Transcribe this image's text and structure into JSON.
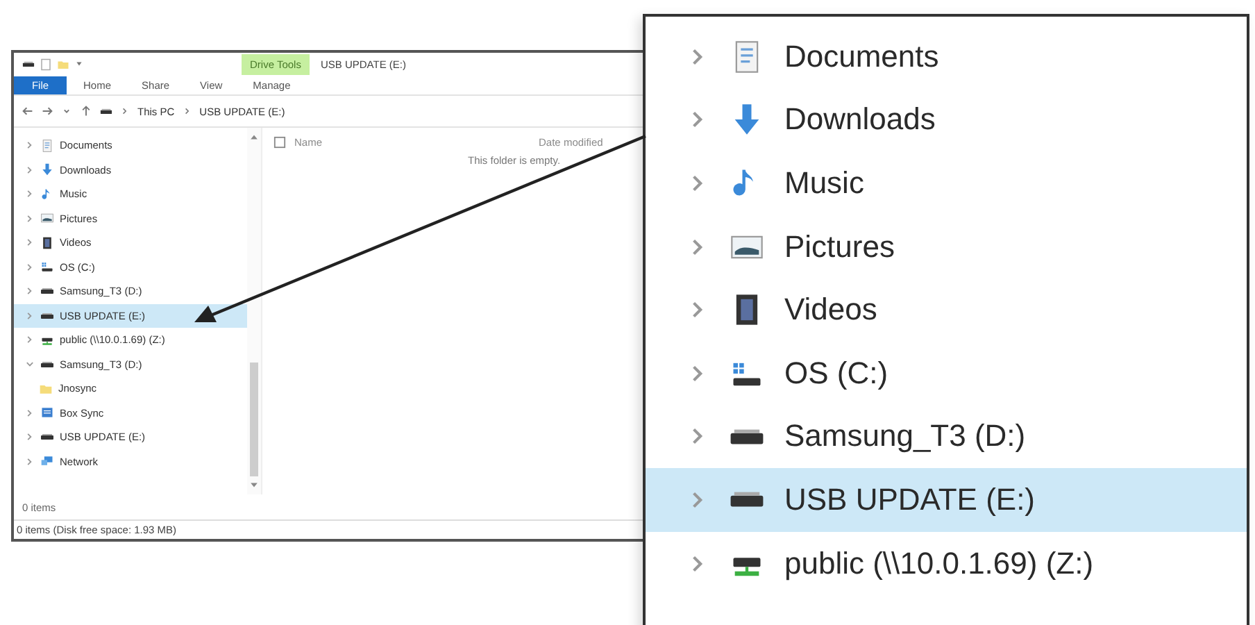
{
  "explorer": {
    "title_bar": {
      "context_tab": "Drive Tools",
      "title": "USB UPDATE (E:)"
    },
    "ribbon_tabs": [
      {
        "label": "File",
        "kind": "file"
      },
      {
        "label": "Home",
        "kind": "tab"
      },
      {
        "label": "Share",
        "kind": "tab"
      },
      {
        "label": "View",
        "kind": "tab"
      },
      {
        "label": "Manage",
        "kind": "tab"
      }
    ],
    "address": [
      "This PC",
      "USB UPDATE (E:)"
    ],
    "nav_tree": [
      {
        "label": "Documents",
        "kind": "documents",
        "expandable": true,
        "expanded": false,
        "selected": false
      },
      {
        "label": "Downloads",
        "kind": "downloads",
        "expandable": true,
        "expanded": false,
        "selected": false
      },
      {
        "label": "Music",
        "kind": "music",
        "expandable": true,
        "expanded": false,
        "selected": false
      },
      {
        "label": "Pictures",
        "kind": "pictures",
        "expandable": true,
        "expanded": false,
        "selected": false
      },
      {
        "label": "Videos",
        "kind": "videos",
        "expandable": true,
        "expanded": false,
        "selected": false
      },
      {
        "label": "OS (C:)",
        "kind": "system_drive",
        "expandable": true,
        "expanded": false,
        "selected": false
      },
      {
        "label": "Samsung_T3 (D:)",
        "kind": "drive",
        "expandable": true,
        "expanded": false,
        "selected": false
      },
      {
        "label": "USB UPDATE (E:)",
        "kind": "drive",
        "expandable": true,
        "expanded": false,
        "selected": true
      },
      {
        "label": "public (\\\\10.0.1.69) (Z:)",
        "kind": "network_drive",
        "expandable": true,
        "expanded": false,
        "selected": false
      },
      {
        "label": "Samsung_T3 (D:)",
        "kind": "drive",
        "expandable": true,
        "expanded": true,
        "selected": false,
        "children": [
          {
            "label": "Jnosync",
            "kind": "folder",
            "expandable": false,
            "expanded": false,
            "selected": false
          },
          {
            "label": "Box Sync",
            "kind": "box",
            "expandable": true,
            "expanded": false,
            "selected": false
          }
        ]
      },
      {
        "label": "USB UPDATE (E:)",
        "kind": "drive",
        "expandable": true,
        "expanded": false,
        "selected": false
      },
      {
        "label": "Network",
        "kind": "network",
        "expandable": true,
        "expanded": false,
        "selected": false
      }
    ],
    "columns": [
      "Name",
      "Date modified"
    ],
    "empty_message": "This folder is empty.",
    "item_count": "0 items",
    "status_bar": "0 items (Disk free space: 1.93 MB)"
  },
  "callout": {
    "items": [
      {
        "label": "Documents",
        "kind": "documents",
        "selected": false
      },
      {
        "label": "Downloads",
        "kind": "downloads",
        "selected": false
      },
      {
        "label": "Music",
        "kind": "music",
        "selected": false
      },
      {
        "label": "Pictures",
        "kind": "pictures",
        "selected": false
      },
      {
        "label": "Videos",
        "kind": "videos",
        "selected": false
      },
      {
        "label": "OS (C:)",
        "kind": "system_drive",
        "selected": false
      },
      {
        "label": "Samsung_T3 (D:)",
        "kind": "drive",
        "selected": false
      },
      {
        "label": "USB UPDATE (E:)",
        "kind": "drive",
        "selected": true
      },
      {
        "label": "public (\\\\10.0.1.69) (Z:)",
        "kind": "network_drive",
        "selected": false
      }
    ]
  }
}
